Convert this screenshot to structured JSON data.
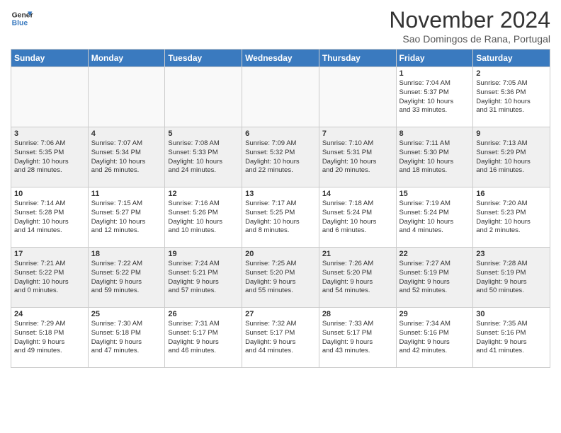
{
  "header": {
    "logo_line1": "General",
    "logo_line2": "Blue",
    "month": "November 2024",
    "location": "Sao Domingos de Rana, Portugal"
  },
  "days_of_week": [
    "Sunday",
    "Monday",
    "Tuesday",
    "Wednesday",
    "Thursday",
    "Friday",
    "Saturday"
  ],
  "weeks": [
    [
      {
        "day": "",
        "info": ""
      },
      {
        "day": "",
        "info": ""
      },
      {
        "day": "",
        "info": ""
      },
      {
        "day": "",
        "info": ""
      },
      {
        "day": "",
        "info": ""
      },
      {
        "day": "1",
        "info": "Sunrise: 7:04 AM\nSunset: 5:37 PM\nDaylight: 10 hours\nand 33 minutes."
      },
      {
        "day": "2",
        "info": "Sunrise: 7:05 AM\nSunset: 5:36 PM\nDaylight: 10 hours\nand 31 minutes."
      }
    ],
    [
      {
        "day": "3",
        "info": "Sunrise: 7:06 AM\nSunset: 5:35 PM\nDaylight: 10 hours\nand 28 minutes."
      },
      {
        "day": "4",
        "info": "Sunrise: 7:07 AM\nSunset: 5:34 PM\nDaylight: 10 hours\nand 26 minutes."
      },
      {
        "day": "5",
        "info": "Sunrise: 7:08 AM\nSunset: 5:33 PM\nDaylight: 10 hours\nand 24 minutes."
      },
      {
        "day": "6",
        "info": "Sunrise: 7:09 AM\nSunset: 5:32 PM\nDaylight: 10 hours\nand 22 minutes."
      },
      {
        "day": "7",
        "info": "Sunrise: 7:10 AM\nSunset: 5:31 PM\nDaylight: 10 hours\nand 20 minutes."
      },
      {
        "day": "8",
        "info": "Sunrise: 7:11 AM\nSunset: 5:30 PM\nDaylight: 10 hours\nand 18 minutes."
      },
      {
        "day": "9",
        "info": "Sunrise: 7:13 AM\nSunset: 5:29 PM\nDaylight: 10 hours\nand 16 minutes."
      }
    ],
    [
      {
        "day": "10",
        "info": "Sunrise: 7:14 AM\nSunset: 5:28 PM\nDaylight: 10 hours\nand 14 minutes."
      },
      {
        "day": "11",
        "info": "Sunrise: 7:15 AM\nSunset: 5:27 PM\nDaylight: 10 hours\nand 12 minutes."
      },
      {
        "day": "12",
        "info": "Sunrise: 7:16 AM\nSunset: 5:26 PM\nDaylight: 10 hours\nand 10 minutes."
      },
      {
        "day": "13",
        "info": "Sunrise: 7:17 AM\nSunset: 5:25 PM\nDaylight: 10 hours\nand 8 minutes."
      },
      {
        "day": "14",
        "info": "Sunrise: 7:18 AM\nSunset: 5:24 PM\nDaylight: 10 hours\nand 6 minutes."
      },
      {
        "day": "15",
        "info": "Sunrise: 7:19 AM\nSunset: 5:24 PM\nDaylight: 10 hours\nand 4 minutes."
      },
      {
        "day": "16",
        "info": "Sunrise: 7:20 AM\nSunset: 5:23 PM\nDaylight: 10 hours\nand 2 minutes."
      }
    ],
    [
      {
        "day": "17",
        "info": "Sunrise: 7:21 AM\nSunset: 5:22 PM\nDaylight: 10 hours\nand 0 minutes."
      },
      {
        "day": "18",
        "info": "Sunrise: 7:22 AM\nSunset: 5:22 PM\nDaylight: 9 hours\nand 59 minutes."
      },
      {
        "day": "19",
        "info": "Sunrise: 7:24 AM\nSunset: 5:21 PM\nDaylight: 9 hours\nand 57 minutes."
      },
      {
        "day": "20",
        "info": "Sunrise: 7:25 AM\nSunset: 5:20 PM\nDaylight: 9 hours\nand 55 minutes."
      },
      {
        "day": "21",
        "info": "Sunrise: 7:26 AM\nSunset: 5:20 PM\nDaylight: 9 hours\nand 54 minutes."
      },
      {
        "day": "22",
        "info": "Sunrise: 7:27 AM\nSunset: 5:19 PM\nDaylight: 9 hours\nand 52 minutes."
      },
      {
        "day": "23",
        "info": "Sunrise: 7:28 AM\nSunset: 5:19 PM\nDaylight: 9 hours\nand 50 minutes."
      }
    ],
    [
      {
        "day": "24",
        "info": "Sunrise: 7:29 AM\nSunset: 5:18 PM\nDaylight: 9 hours\nand 49 minutes."
      },
      {
        "day": "25",
        "info": "Sunrise: 7:30 AM\nSunset: 5:18 PM\nDaylight: 9 hours\nand 47 minutes."
      },
      {
        "day": "26",
        "info": "Sunrise: 7:31 AM\nSunset: 5:17 PM\nDaylight: 9 hours\nand 46 minutes."
      },
      {
        "day": "27",
        "info": "Sunrise: 7:32 AM\nSunset: 5:17 PM\nDaylight: 9 hours\nand 44 minutes."
      },
      {
        "day": "28",
        "info": "Sunrise: 7:33 AM\nSunset: 5:17 PM\nDaylight: 9 hours\nand 43 minutes."
      },
      {
        "day": "29",
        "info": "Sunrise: 7:34 AM\nSunset: 5:16 PM\nDaylight: 9 hours\nand 42 minutes."
      },
      {
        "day": "30",
        "info": "Sunrise: 7:35 AM\nSunset: 5:16 PM\nDaylight: 9 hours\nand 41 minutes."
      }
    ]
  ]
}
